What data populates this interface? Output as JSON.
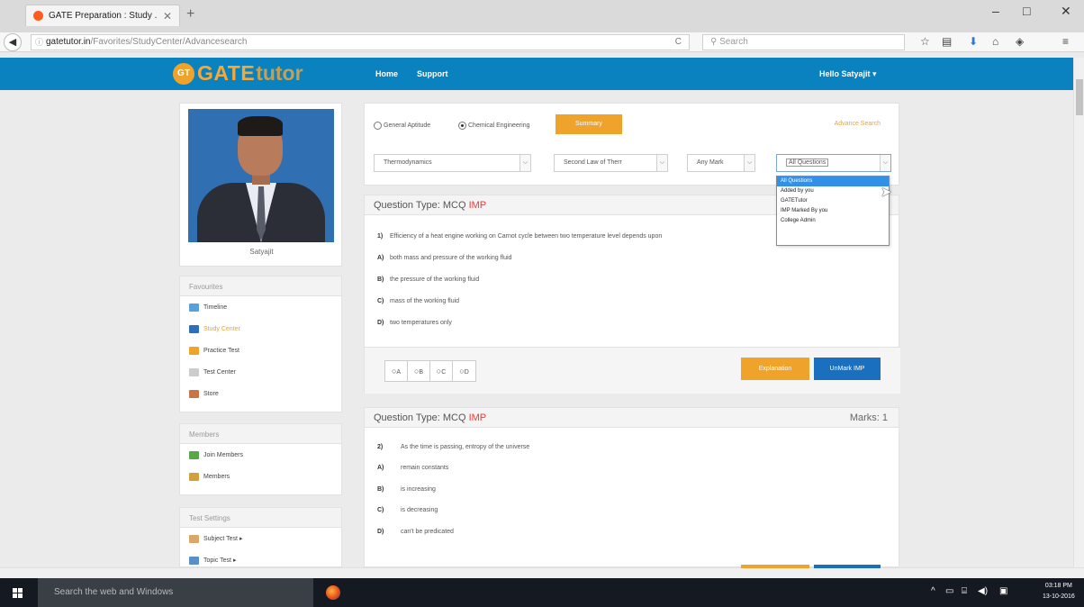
{
  "browser": {
    "tab_title": "GATE Preparation : Study ...",
    "tab_close": "✕",
    "new_tab": "+",
    "url_host": "gatetutor.in",
    "url_path": "/Favorites/StudyCenter/Advancesearch",
    "reload_icon": "C",
    "search_placeholder": "Search",
    "win_min": "–",
    "win_max": "□",
    "win_close": "✕"
  },
  "site": {
    "logo_badge": "GT",
    "logo_text_1": "GATE",
    "logo_text_2": "tutor",
    "nav_home": "Home",
    "nav_support": "Support",
    "user_greeting": "Hello Satyajit ▾"
  },
  "profile": {
    "name": "Satyajit"
  },
  "sidebar": {
    "favourites_title": "Favourites",
    "favourites": [
      {
        "label": "Timeline",
        "color": "#5aa0d8"
      },
      {
        "label": "Study Center",
        "color": "#2e6fb8"
      },
      {
        "label": "Practice Test",
        "color": "#f0a32a"
      },
      {
        "label": "Test Center",
        "color": "#cccccc"
      },
      {
        "label": "Store",
        "color": "#c9734a"
      }
    ],
    "members_title": "Members",
    "members": [
      {
        "label": "Join Members",
        "color": "#58a84a"
      },
      {
        "label": "Members",
        "color": "#d2a23a"
      }
    ],
    "settings_title": "Test Settings",
    "settings": [
      {
        "label": "Subject Test ▸",
        "color": "#d8a86a"
      },
      {
        "label": "Topic Test ▸",
        "color": "#5a8fc8"
      }
    ]
  },
  "filter": {
    "radio_general": "General Aptitude",
    "radio_chemical": "Chemical Engineering",
    "summary_button": "Summary",
    "advance_search": "Advance Search",
    "subject_select": "Thermodynamics",
    "topic_select": "Second Law of Therr",
    "mark_select": "Any Mark",
    "question_select": "All Questions",
    "dropdown_options": [
      "All Questions",
      "Added by you",
      "GATETutor",
      "IMP Marked By you",
      "College Admin"
    ]
  },
  "questions": [
    {
      "type_label": "Question Type: MCQ",
      "imp": "IMP",
      "marks": "",
      "number": "1)",
      "text": "Efficiency of a heat engine working on Carnot cycle between two temperature level depends upon",
      "options": [
        {
          "label": "A)",
          "text": "both mass and pressure of the working fluid"
        },
        {
          "label": "B)",
          "text": "the pressure of the working fluid"
        },
        {
          "label": "C)",
          "text": "mass of the working fluid"
        },
        {
          "label": "D)",
          "text": "two temperatures only"
        }
      ],
      "answer_buttons": [
        "A",
        "B",
        "C",
        "D"
      ],
      "explanation_button": "Explanation",
      "unmark_button": "UnMark IMP"
    },
    {
      "type_label": "Question Type: MCQ",
      "imp": "IMP",
      "marks": "Marks: 1",
      "number": "2)",
      "text": "As the time is passing, entropy of the universe",
      "options": [
        {
          "label": "A)",
          "text": "remain constants"
        },
        {
          "label": "B)",
          "text": "is increasing"
        },
        {
          "label": "C)",
          "text": "is decreasing"
        },
        {
          "label": "D)",
          "text": "can't be predicated"
        }
      ]
    }
  ],
  "taskbar": {
    "search_text": "Search the web and Windows",
    "time": "03:18 PM",
    "date": "13-10-2016"
  }
}
